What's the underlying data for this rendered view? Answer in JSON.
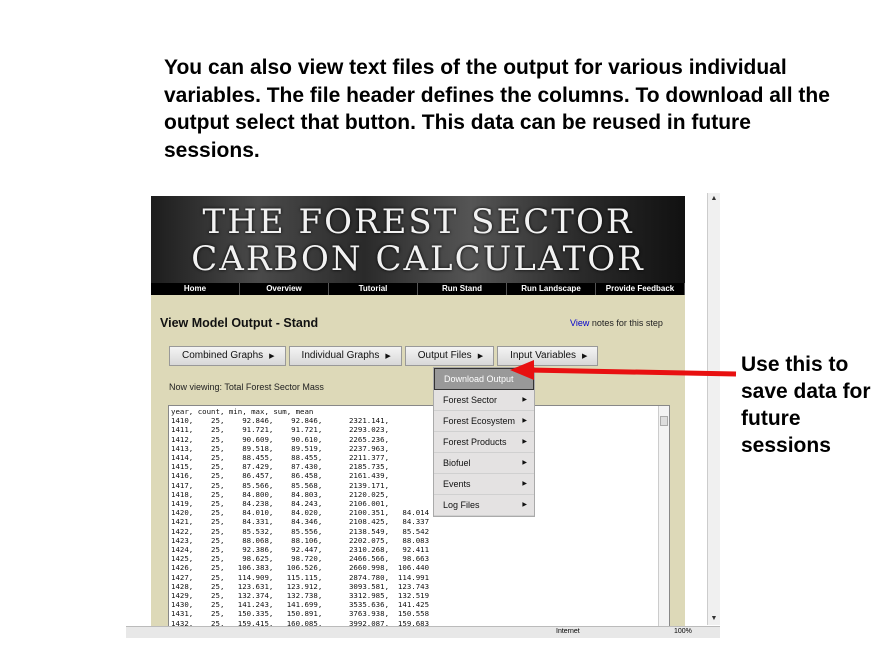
{
  "caption": "You can also view text files of the output for various individual variables.  The file header defines the columns. To download all the output select that button.  This data can be reused in future sessions.",
  "callout": "Use this to save data for future sessions",
  "banner": {
    "line1": "THE FOREST SECTOR",
    "line2": "CARBON CALCULATOR"
  },
  "nav": [
    "Home",
    "Overview",
    "Tutorial",
    "Run Stand",
    "Run Landscape",
    "Provide Feedback"
  ],
  "page_title": "View Model Output - Stand",
  "notes": {
    "link": "View",
    "text": " notes for this step"
  },
  "tabs": [
    "Combined Graphs",
    "Individual Graphs",
    "Output Files",
    "Input Variables"
  ],
  "viewing": "Now viewing: Total Forest Sector Mass",
  "menu": [
    {
      "label": "Download Output",
      "submenu": false,
      "selected": true
    },
    {
      "label": "Forest Sector",
      "submenu": true
    },
    {
      "label": "Forest Ecosystem",
      "submenu": true
    },
    {
      "label": "Forest Products",
      "submenu": true
    },
    {
      "label": "Biofuel",
      "submenu": true
    },
    {
      "label": "Events",
      "submenu": true
    },
    {
      "label": "Log Files",
      "submenu": true
    }
  ],
  "file_text": "year, count, min, max, sum, mean\n1410,    25,    92.846,    92.846,      2321.141,\n1411,    25,    91.721,    91.721,      2293.023,\n1412,    25,    90.609,    90.610,      2265.236,\n1413,    25,    89.518,    89.519,      2237.963,\n1414,    25,    88.455,    88.455,      2211.377,\n1415,    25,    87.429,    87.430,      2185.735,\n1416,    25,    86.457,    86.458,      2161.439,\n1417,    25,    85.566,    85.568,      2139.171,\n1418,    25,    84.800,    84.803,      2120.025,\n1419,    25,    84.238,    84.243,      2106.001,\n1420,    25,    84.010,    84.020,      2100.351,   84.014\n1421,    25,    84.331,    84.346,      2108.425,   84.337\n1422,    25,    85.532,    85.556,      2138.549,   85.542\n1423,    25,    88.068,    88.106,      2202.075,   88.083\n1424,    25,    92.386,    92.447,      2310.268,   92.411\n1425,    25,    98.625,    98.720,      2466.566,   98.663\n1426,    25,   106.383,   106.526,      2660.998,  106.440\n1427,    25,   114.909,   115.115,      2874.780,  114.991\n1428,    25,   123.631,   123.912,      3093.581,  123.743\n1429,    25,   132.374,   132.738,      3312.985,  132.519\n1430,    25,   141.243,   141.699,      3535.636,  141.425\n1431,    25,   150.335,   150.891,      3763.938,  150.558\n1432,    25,   159.415,   160.085,      3992.087,  159.683",
  "status": {
    "zone": "Internet",
    "zoom": "100%"
  },
  "colors": {
    "arrow": "#e81010",
    "page_bg": "#ddd9b8",
    "menu_selected": "#999999"
  }
}
